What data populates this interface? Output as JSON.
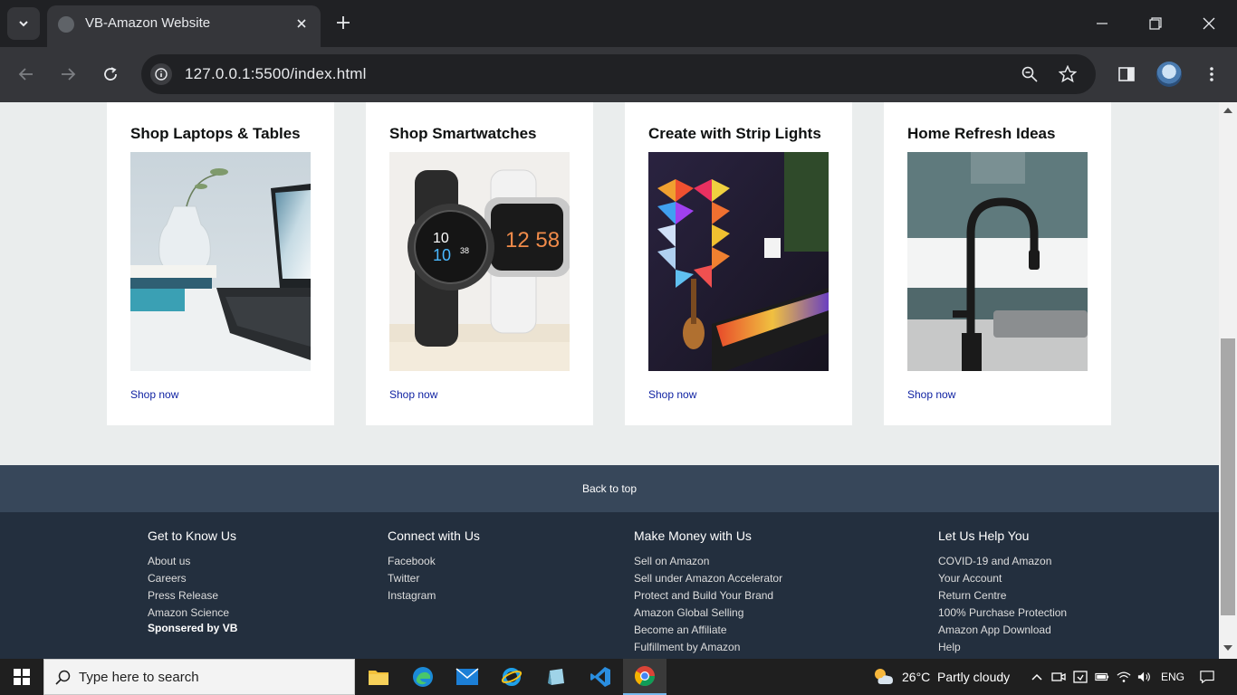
{
  "browser": {
    "tab_title": "VB-Amazon Website",
    "url": "127.0.0.1:5500/index.html"
  },
  "cards": [
    {
      "title": "Shop Laptops & Tables",
      "link": "Shop now",
      "image": "laptop-vase-photo"
    },
    {
      "title": "Shop Smartwatches",
      "link": "Shop now",
      "image": "smartwatches-photo"
    },
    {
      "title": "Create with Strip Lights",
      "link": "Shop now",
      "image": "strip-lights-photo"
    },
    {
      "title": "Home Refresh Ideas",
      "link": "Shop now",
      "image": "kitchen-faucet-photo"
    }
  ],
  "back_to_top": "Back to top",
  "footer": {
    "columns": [
      {
        "heading": "Get to Know Us",
        "links": [
          "About us",
          "Careers",
          "Press Release",
          "Amazon Science"
        ]
      },
      {
        "heading": "Connect with Us",
        "links": [
          "Facebook",
          "Twitter",
          "Instagram"
        ]
      },
      {
        "heading": "Make Money with Us",
        "links": [
          "Sell on Amazon",
          "Sell under Amazon Accelerator",
          "Protect and Build Your Brand",
          "Amazon Global Selling",
          "Become an Affiliate",
          "Fulfillment by Amazon"
        ]
      },
      {
        "heading": "Let Us Help You",
        "links": [
          "COVID-19 and Amazon",
          "Your Account",
          "Return Centre",
          "100% Purchase Protection",
          "Amazon App Download",
          "Help"
        ]
      }
    ],
    "sponsor": "Sponsered by VB"
  },
  "taskbar": {
    "search_placeholder": "Type here to search",
    "temperature": "26°C",
    "weather": "Partly cloudy",
    "language": "ENG"
  },
  "colors": {
    "footer_bg": "#232f3e",
    "back_to_top_bg": "#37475a",
    "link": "#0c1fa1",
    "page_bg": "#eaeded"
  }
}
